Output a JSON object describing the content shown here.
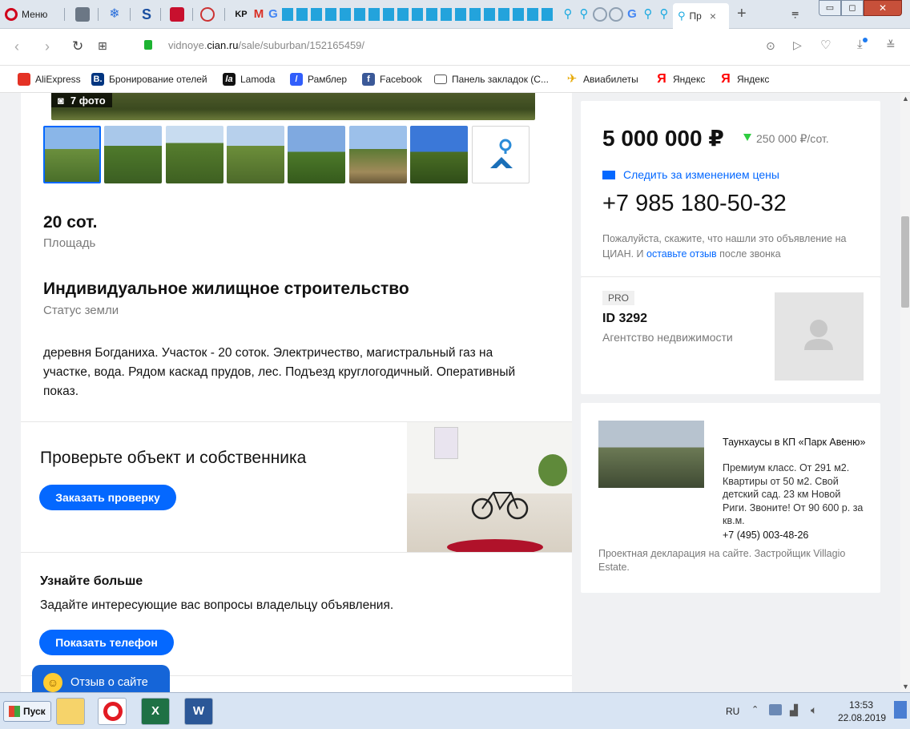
{
  "browser": {
    "menu_label": "Меню",
    "active_tab_label": "Пр",
    "url_domain": "cian.ru",
    "url_prefix": "vidnoye.",
    "url_path": "/sale/suburban/152165459/",
    "bookmarks": [
      {
        "label": "AliExpress",
        "color": "#e43225",
        "glyph": "A"
      },
      {
        "label": "Бронирование отелей",
        "color": "#003580",
        "glyph": "B."
      },
      {
        "label": "Lamoda",
        "color": "#111111",
        "glyph": "la"
      },
      {
        "label": "Рамблер",
        "color": "#315efb",
        "glyph": "/"
      },
      {
        "label": "Facebook",
        "color": "#3b5998",
        "glyph": "f"
      },
      {
        "label": "Панель закладок (С...",
        "color": "#ffffff",
        "glyph": "folder"
      },
      {
        "label": "Авиабилеты",
        "color": "#ffffff",
        "glyph": "plane"
      },
      {
        "label": "Яндекс",
        "color": "#ffffff",
        "glyph": "Я"
      },
      {
        "label": "Яндекс",
        "color": "#ffffff",
        "glyph": "Я"
      }
    ]
  },
  "listing": {
    "photo_count": "7 фото",
    "area_value": "20 сот.",
    "area_label": "Площадь",
    "land_status_value": "Индивидуальное жилищное строительство",
    "land_status_label": "Статус земли",
    "description": "деревня Богданиха. Участок - 20 соток. Электричество, магистральный газ на участке, вода. Рядом каскад прудов, лес. Подъезд круглогодичный. Оперативный показ."
  },
  "check_block": {
    "title": "Проверьте объект и собственника",
    "button": "Заказать проверку"
  },
  "learn_block": {
    "title": "Узнайте больше",
    "text": "Задайте интересующие вас вопросы владельцу объявления.",
    "button": "Показать телефон"
  },
  "feedback_widget": {
    "label": "Отзыв о сайте"
  },
  "price_card": {
    "price": "5 000 000 ₽",
    "price_per_unit": "250 000 ₽/сот.",
    "follow_label": "Следить за изменением цены",
    "phone": "+7 985 180-50-32",
    "note_before": "Пожалуйста, скажите, что нашли это объявление на ЦИАН. И ",
    "note_link": "оставьте отзыв",
    "note_after": " после звонка"
  },
  "agent_card": {
    "badge": "PRO",
    "id_label": "ID 3292",
    "type": "Агентство недвижимости"
  },
  "ad_card": {
    "title": "Таунхаусы в КП «Парк Авеню»",
    "body": "Премиум класс. От 291 м2. Квартиры от 50 м2. Свой детский сад. 23 км Новой Риги. Звоните! От 90 600 р. за кв.м.",
    "phone": "+7 (495) 003-48-26",
    "footer": "Проектная декларация на сайте. Застройщик Villagio Estate."
  },
  "taskbar": {
    "start_label": "Пуск",
    "lang": "RU",
    "time": "13:53",
    "date": "22.08.2019"
  },
  "colors": {
    "accent": "#0468ff",
    "price_drop": "#2ecc40",
    "page_bg": "#f0f1f3"
  }
}
